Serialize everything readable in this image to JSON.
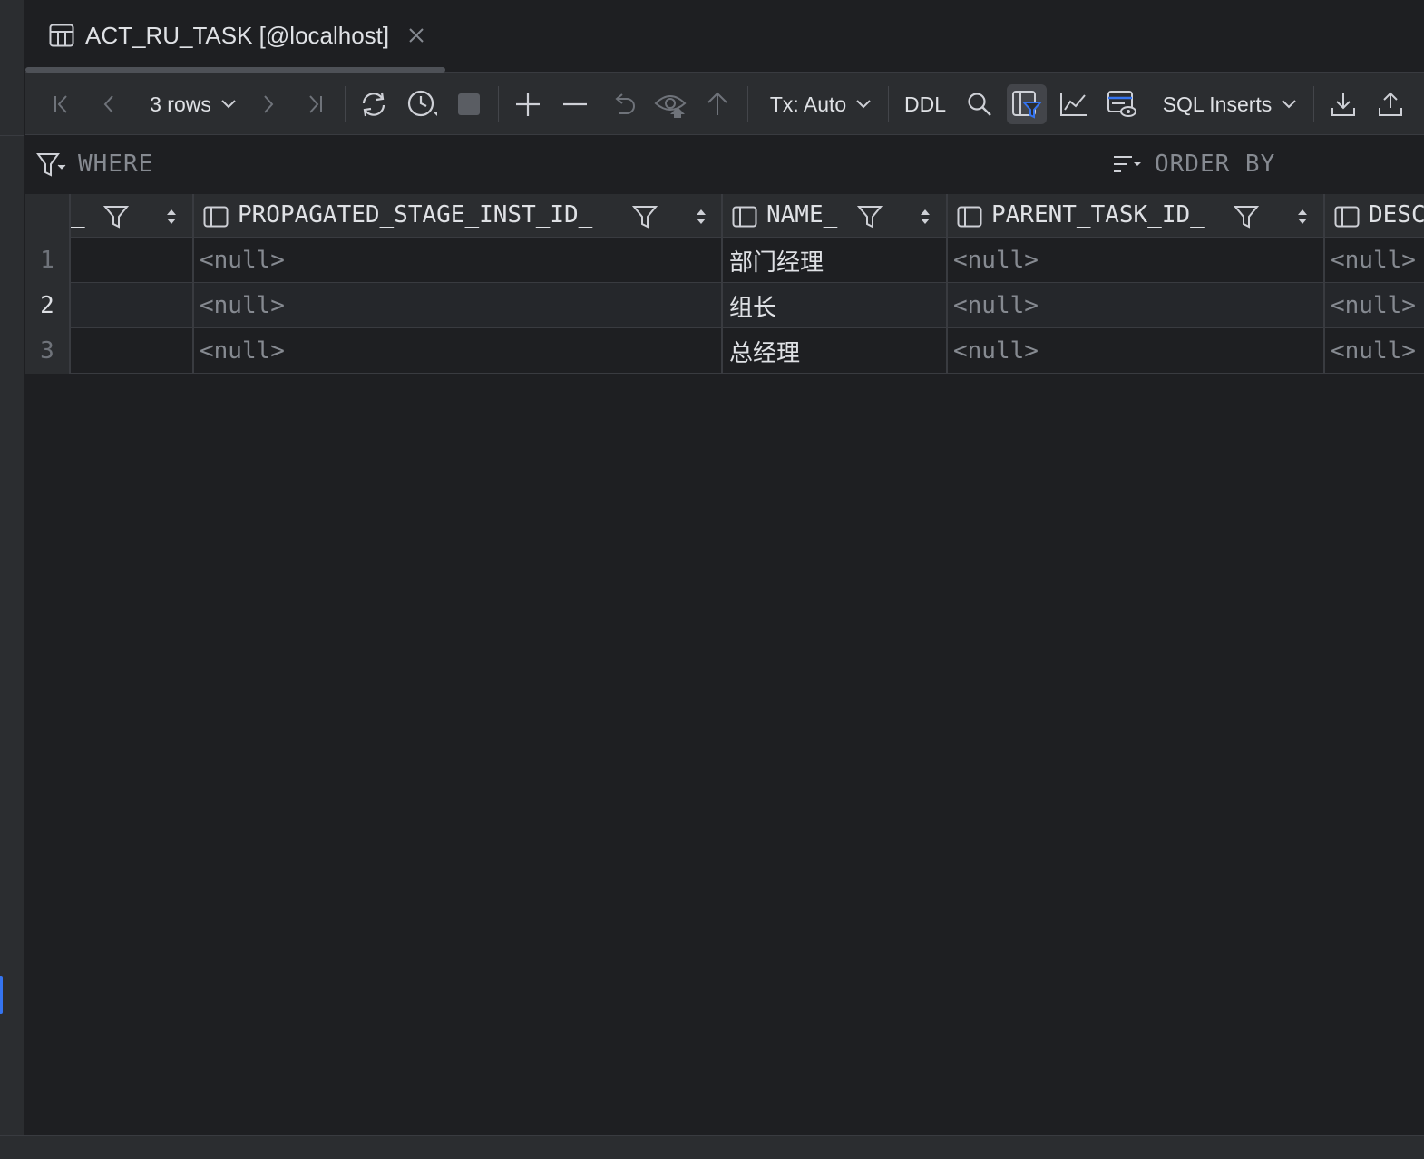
{
  "tab": {
    "title": "ACT_RU_TASK [@localhost]"
  },
  "toolbar": {
    "rows_label": "3 rows",
    "tx_label": "Tx: Auto",
    "ddl_label": "DDL",
    "export_format_label": "SQL Inserts"
  },
  "filters": {
    "where_label": "WHERE",
    "order_by_label": "ORDER BY"
  },
  "columns": [
    {
      "label": "_"
    },
    {
      "label": "PROPAGATED_STAGE_INST_ID_"
    },
    {
      "label": "NAME_"
    },
    {
      "label": "PARENT_TASK_ID_"
    },
    {
      "label": "DESC"
    }
  ],
  "rows": [
    {
      "num": "1",
      "propagated": "<null>",
      "name": "部门经理",
      "parent": "<null>",
      "desc": "<null>"
    },
    {
      "num": "2",
      "propagated": "<null>",
      "name": "组长",
      "parent": "<null>",
      "desc": "<null>"
    },
    {
      "num": "3",
      "propagated": "<null>",
      "name": "总经理",
      "parent": "<null>",
      "desc": "<null>"
    }
  ],
  "colors": {
    "background": "#1e1f22",
    "toolbar": "#2b2d30",
    "accent": "#3574f0",
    "null_text": "#868a91"
  }
}
